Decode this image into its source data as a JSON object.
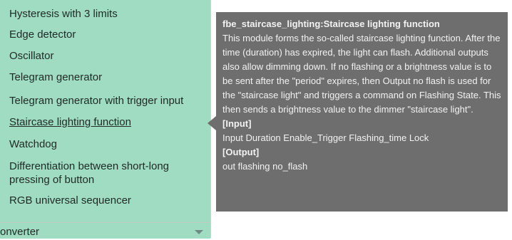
{
  "menu": {
    "items": [
      {
        "label": "Hysteresis with 3 limits"
      },
      {
        "label": "Edge detector"
      },
      {
        "label": "Oscillator"
      },
      {
        "label": "Telegram generator"
      },
      {
        "label": "Telegram generator with trigger input"
      },
      {
        "label": "Staircase lighting function",
        "active": true
      },
      {
        "label": "Watchdog"
      },
      {
        "label": "Differentiation between short-long pressing of button"
      },
      {
        "label": "RGB universal sequencer"
      }
    ],
    "footer_label": "onverter",
    "footer_icon": "chevron-down-icon"
  },
  "tooltip": {
    "title": "fbe_staircase_lighting:Staircase lighting function",
    "description": "This module forms the so-called staircase lighting function. After the time (duration) has expired, the light can flash. Additional outputs also allow dimming down. If no flashing or a brightness value is to be sent after the \"period\" expires, then Output no flash is used for the \"staircase light\" and triggers a command on Flashing State. This then sends a brightness value to the dimmer \"staircase light\".",
    "input_heading": "[Input]",
    "input_text": "Input Duration Enable_Trigger Flashing_time Lock",
    "output_heading": "[Output]",
    "output_text": "out flashing no_flash"
  },
  "colors": {
    "menu_background": "#9fdcc1",
    "tooltip_background": "#6e6e6e",
    "tooltip_text": "#f2f2f2"
  }
}
